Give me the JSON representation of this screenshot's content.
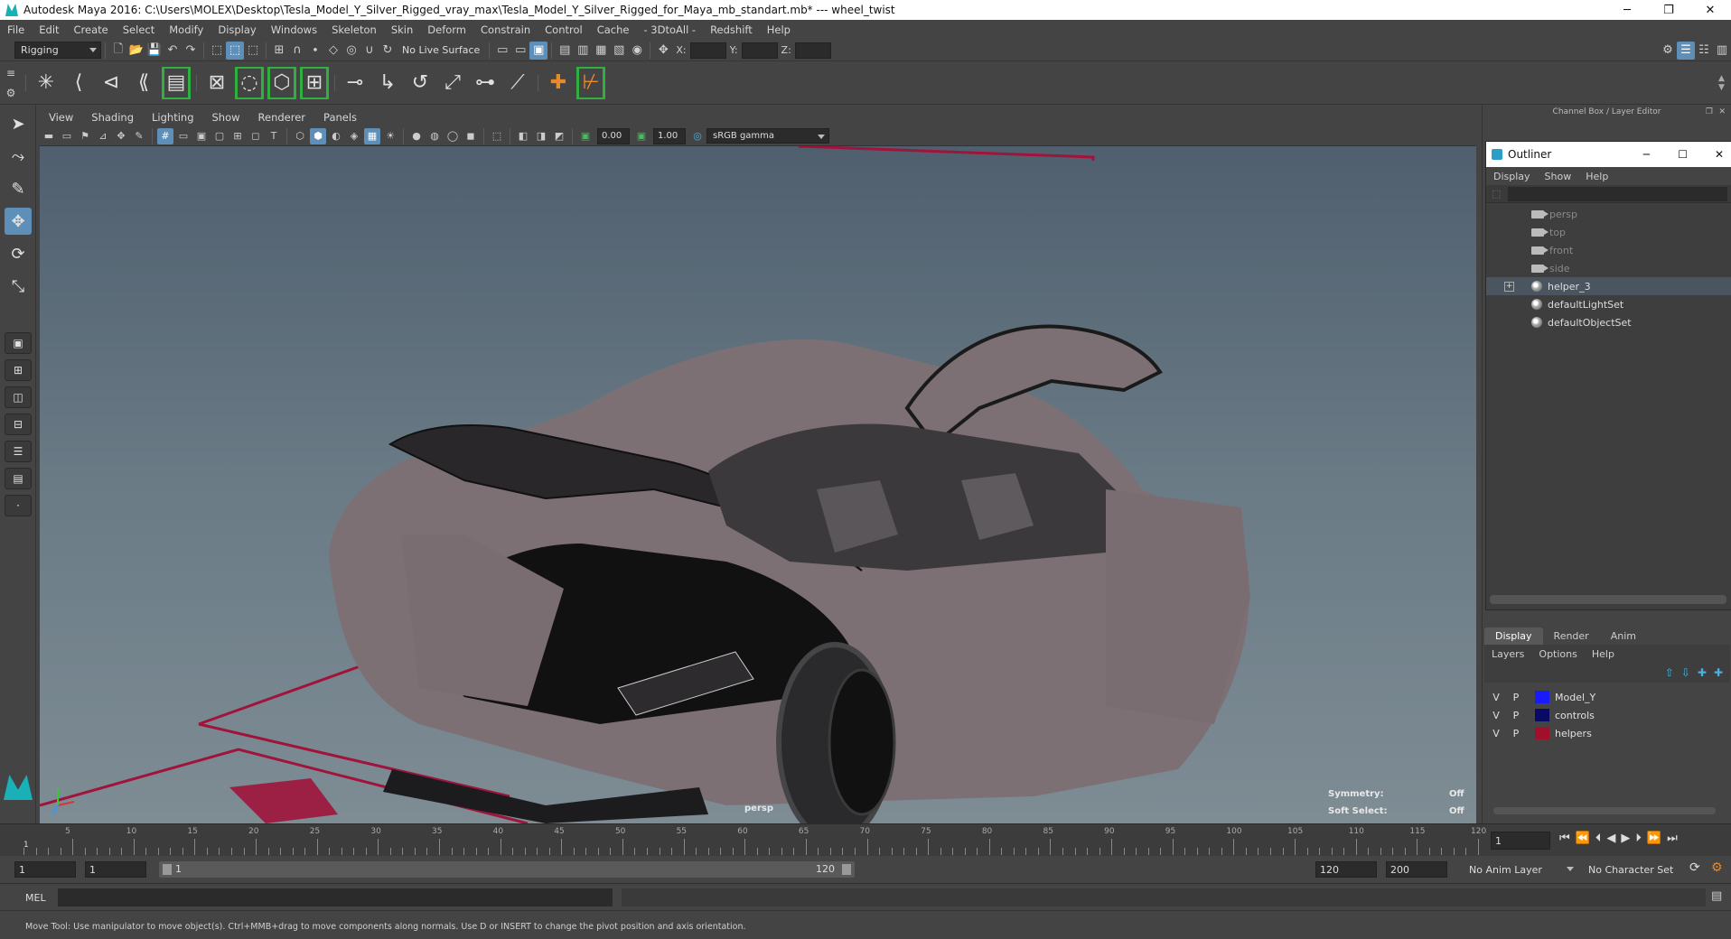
{
  "window": {
    "title": "Autodesk Maya 2016: C:\\Users\\MOLEX\\Desktop\\Tesla_Model_Y_Silver_Rigged_vray_max\\Tesla_Model_Y_Silver_Rigged_for_Maya_mb_standart.mb*  ---  wheel_twist",
    "minimize": "─",
    "restore": "❐",
    "close": "✕"
  },
  "menubar": [
    "File",
    "Edit",
    "Create",
    "Select",
    "Modify",
    "Display",
    "Windows",
    "Skeleton",
    "Skin",
    "Deform",
    "Constrain",
    "Control",
    "Cache",
    "- 3DtoAll -",
    "Redshift",
    "Help"
  ],
  "statusline": {
    "menuset": "Rigging",
    "live_surface": "No Live Surface",
    "x_label": "X:",
    "y_label": "Y:",
    "z_label": "Z:"
  },
  "viewport": {
    "menu": [
      "View",
      "Shading",
      "Lighting",
      "Show",
      "Renderer",
      "Panels"
    ],
    "exposure": "0.00",
    "gamma": "1.00",
    "color_space": "sRGB gamma",
    "camera_label": "persp",
    "symmetry_label": "Symmetry:",
    "symmetry_value": "Off",
    "soft_select_label": "Soft Select:",
    "soft_select_value": "Off",
    "colors": {
      "car_body": "#7d7075",
      "rig_lines": "#a0143c"
    }
  },
  "rightpanel": {
    "header": "Channel Box / Layer Editor",
    "outliner": {
      "title": "Outliner",
      "menu": [
        "Display",
        "Show",
        "Help"
      ],
      "items": [
        {
          "label": "persp",
          "icon": "camera-icon",
          "dim": true
        },
        {
          "label": "top",
          "icon": "camera-icon",
          "dim": true
        },
        {
          "label": "front",
          "icon": "camera-icon",
          "dim": true
        },
        {
          "label": "side",
          "icon": "camera-icon",
          "dim": true
        },
        {
          "label": "helper_3",
          "icon": "group-icon",
          "dim": false
        },
        {
          "label": "defaultLightSet",
          "icon": "set-icon",
          "dim": false
        },
        {
          "label": "defaultObjectSet",
          "icon": "set-icon",
          "dim": false
        }
      ]
    },
    "layer_tabs": [
      "Display",
      "Render",
      "Anim"
    ],
    "layer_menu": [
      "Layers",
      "Options",
      "Help"
    ],
    "layers": [
      {
        "v": "V",
        "p": "P",
        "name": "Model_Y",
        "color": "#1a1aff"
      },
      {
        "v": "V",
        "p": "P",
        "name": "controls",
        "color": "#0a0a66"
      },
      {
        "v": "V",
        "p": "P",
        "name": "helpers",
        "color": "#a0102a"
      }
    ]
  },
  "timeline": {
    "ticks": [
      "5",
      "10",
      "15",
      "20",
      "25",
      "30",
      "35",
      "40",
      "45",
      "50",
      "55",
      "60",
      "65",
      "70",
      "75",
      "80",
      "85",
      "90",
      "95",
      "100",
      "105",
      "110",
      "115",
      "120"
    ],
    "first": "1",
    "current_frame": "1"
  },
  "range": {
    "start": "1",
    "playback_start": "1",
    "slider_start": "1",
    "slider_end": "120",
    "playback_end": "120",
    "end": "200",
    "anim_layer": "No Anim Layer",
    "character_set": "No Character Set"
  },
  "cmdline": {
    "label": "MEL"
  },
  "helpline": {
    "text": "Move Tool: Use manipulator to move object(s). Ctrl+MMB+drag to move components along normals. Use D or INSERT to change the pivot position and axis orientation."
  }
}
